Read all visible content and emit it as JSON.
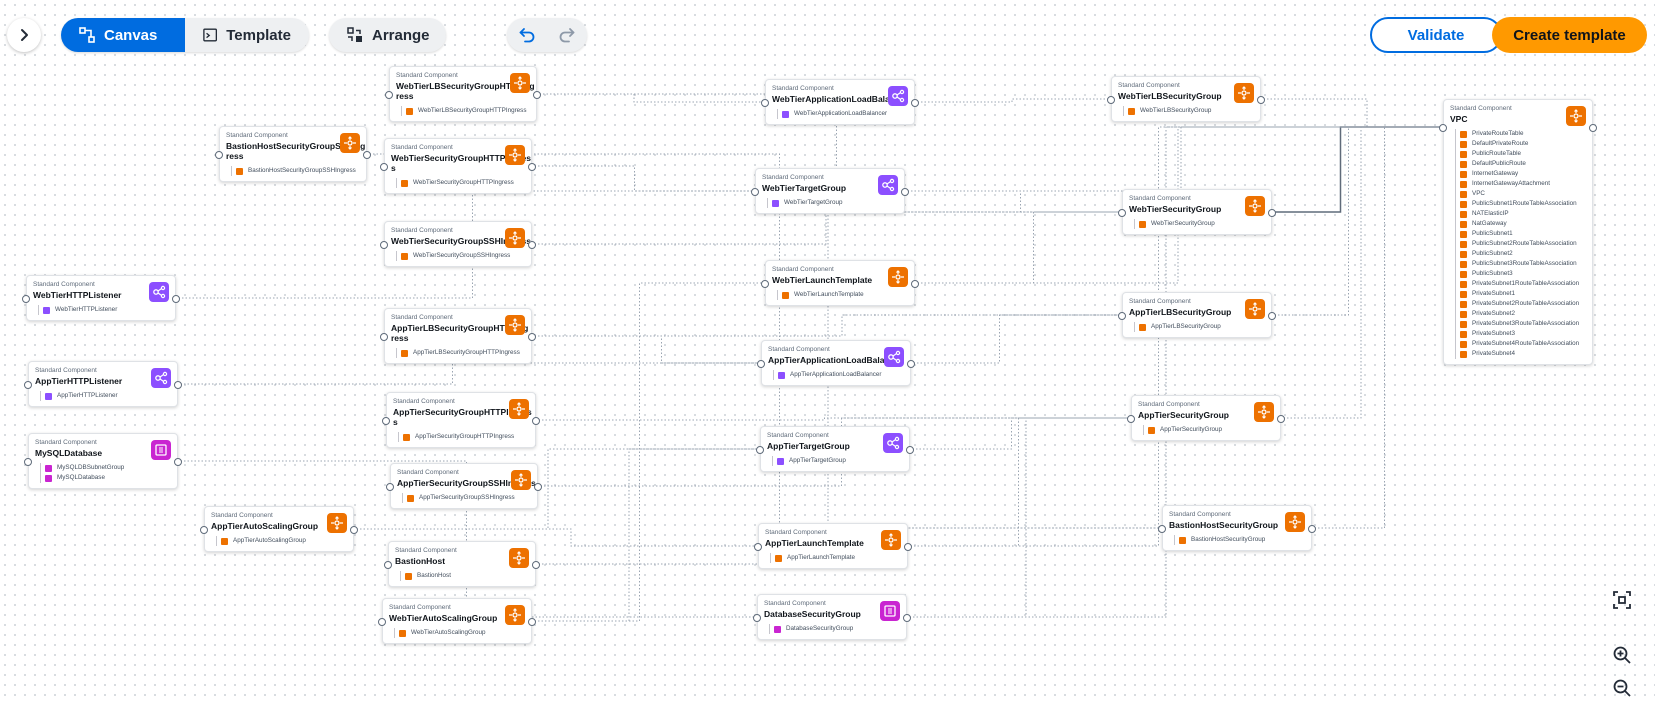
{
  "toolbar": {
    "canvas_label": "Canvas",
    "template_label": "Template",
    "arrange_label": "Arrange",
    "validate_label": "Validate",
    "create_label": "Create template"
  },
  "colors": {
    "accent": "#006ce0",
    "primary_action": "#ff9900",
    "compute": "#ed7100",
    "network": "#8c4fff",
    "database": "#c925d1"
  },
  "icons": {
    "expand": "chevron-right-icon",
    "canvas": "canvas-icon",
    "template": "terminal-icon",
    "arrange": "arrange-icon",
    "undo": "undo-icon",
    "redo": "redo-icon",
    "fit": "fit-view-icon",
    "zoom_in": "zoom-in-icon",
    "zoom_out": "zoom-out-icon"
  },
  "component_kind": "Standard Component",
  "cards": [
    {
      "title": "WebTierLBSecurityGroupHTTPIngress",
      "cat": "compute",
      "resources": [
        {
          "name": "WebTierLBSecurityGroupHTTPIngress",
          "cat": "compute"
        }
      ]
    },
    {
      "title": "BastionHostSecurityGroupSSHIngress",
      "cat": "compute",
      "resources": [
        {
          "name": "BastionHostSecurityGroupSSHIngress",
          "cat": "compute"
        }
      ]
    },
    {
      "title": "WebTierSecurityGroupHTTPIngress",
      "cat": "compute",
      "resources": [
        {
          "name": "WebTierSecurityGroupHTTPIngress",
          "cat": "compute"
        }
      ]
    },
    {
      "title": "WebTierSecurityGroupSSHIngress",
      "cat": "compute",
      "resources": [
        {
          "name": "WebTierSecurityGroupSSHIngress",
          "cat": "compute"
        }
      ]
    },
    {
      "title": "WebTierHTTPListener",
      "cat": "network",
      "resources": [
        {
          "name": "WebTierHTTPListener",
          "cat": "network"
        }
      ]
    },
    {
      "title": "AppTierLBSecurityGroupHTTPIngress",
      "cat": "compute",
      "resources": [
        {
          "name": "AppTierLBSecurityGroupHTTPIngress",
          "cat": "compute"
        }
      ]
    },
    {
      "title": "AppTierHTTPListener",
      "cat": "network",
      "resources": [
        {
          "name": "AppTierHTTPListener",
          "cat": "network"
        }
      ]
    },
    {
      "title": "AppTierSecurityGroupHTTPIngress",
      "cat": "compute",
      "resources": [
        {
          "name": "AppTierSecurityGroupHTTPIngress",
          "cat": "compute"
        }
      ]
    },
    {
      "title": "MySQLDatabase",
      "cat": "database",
      "resources": [
        {
          "name": "MySQLDBSubnetGroup",
          "cat": "database"
        },
        {
          "name": "MySQLDatabase",
          "cat": "database"
        }
      ]
    },
    {
      "title": "AppTierSecurityGroupSSHIngress",
      "cat": "compute",
      "resources": [
        {
          "name": "AppTierSecurityGroupSSHIngress",
          "cat": "compute"
        }
      ]
    },
    {
      "title": "AppTierAutoScalingGroup",
      "cat": "compute",
      "resources": [
        {
          "name": "AppTierAutoScalingGroup",
          "cat": "compute"
        }
      ]
    },
    {
      "title": "BastionHost",
      "cat": "compute",
      "resources": [
        {
          "name": "BastionHost",
          "cat": "compute"
        }
      ]
    },
    {
      "title": "WebTierAutoScalingGroup",
      "cat": "compute",
      "resources": [
        {
          "name": "WebTierAutoScalingGroup",
          "cat": "compute"
        }
      ]
    },
    {
      "title": "WebTierApplicationLoadBalancer",
      "cat": "network",
      "resources": [
        {
          "name": "WebTierApplicationLoadBalancer",
          "cat": "network"
        }
      ]
    },
    {
      "title": "WebTierTargetGroup",
      "cat": "network",
      "resources": [
        {
          "name": "WebTierTargetGroup",
          "cat": "network"
        }
      ]
    },
    {
      "title": "WebTierLaunchTemplate",
      "cat": "compute",
      "resources": [
        {
          "name": "WebTierLaunchTemplate",
          "cat": "compute"
        }
      ]
    },
    {
      "title": "AppTierApplicationLoadBalancer",
      "cat": "network",
      "resources": [
        {
          "name": "AppTierApplicationLoadBalancer",
          "cat": "network"
        }
      ]
    },
    {
      "title": "AppTierTargetGroup",
      "cat": "network",
      "resources": [
        {
          "name": "AppTierTargetGroup",
          "cat": "network"
        }
      ]
    },
    {
      "title": "AppTierLaunchTemplate",
      "cat": "compute",
      "resources": [
        {
          "name": "AppTierLaunchTemplate",
          "cat": "compute"
        }
      ]
    },
    {
      "title": "DatabaseSecurityGroup",
      "cat": "database",
      "resources": [
        {
          "name": "DatabaseSecurityGroup",
          "cat": "database"
        }
      ]
    },
    {
      "title": "WebTierLBSecurityGroup",
      "cat": "compute",
      "resources": [
        {
          "name": "WebTierLBSecurityGroup",
          "cat": "compute"
        }
      ]
    },
    {
      "title": "WebTierSecurityGroup",
      "cat": "compute",
      "resources": [
        {
          "name": "WebTierSecurityGroup",
          "cat": "compute"
        }
      ]
    },
    {
      "title": "AppTierLBSecurityGroup",
      "cat": "compute",
      "resources": [
        {
          "name": "AppTierLBSecurityGroup",
          "cat": "compute"
        }
      ]
    },
    {
      "title": "AppTierSecurityGroup",
      "cat": "compute",
      "resources": [
        {
          "name": "AppTierSecurityGroup",
          "cat": "compute"
        }
      ]
    },
    {
      "title": "BastionHostSecurityGroup",
      "cat": "compute",
      "resources": [
        {
          "name": "BastionHostSecurityGroup",
          "cat": "compute"
        }
      ]
    },
    {
      "title": "VPC",
      "cat": "compute",
      "resources": [
        {
          "name": "PrivateRouteTable",
          "cat": "compute"
        },
        {
          "name": "DefaultPrivateRoute",
          "cat": "compute"
        },
        {
          "name": "PublicRouteTable",
          "cat": "compute"
        },
        {
          "name": "DefaultPublicRoute",
          "cat": "compute"
        },
        {
          "name": "InternetGateway",
          "cat": "compute"
        },
        {
          "name": "InternetGatewayAttachment",
          "cat": "compute"
        },
        {
          "name": "VPC",
          "cat": "compute"
        },
        {
          "name": "PublicSubnet1RouteTableAssociation",
          "cat": "compute"
        },
        {
          "name": "NATElasticIP",
          "cat": "compute"
        },
        {
          "name": "NatGateway",
          "cat": "compute"
        },
        {
          "name": "PublicSubnet1",
          "cat": "compute"
        },
        {
          "name": "PublicSubnet2RouteTableAssociation",
          "cat": "compute"
        },
        {
          "name": "PublicSubnet2",
          "cat": "compute"
        },
        {
          "name": "PublicSubnet3RouteTableAssociation",
          "cat": "compute"
        },
        {
          "name": "PublicSubnet3",
          "cat": "compute"
        },
        {
          "name": "PrivateSubnet1RouteTableAssociation",
          "cat": "compute"
        },
        {
          "name": "PrivateSubnet1",
          "cat": "compute"
        },
        {
          "name": "PrivateSubnet2RouteTableAssociation",
          "cat": "compute"
        },
        {
          "name": "PrivateSubnet2",
          "cat": "compute"
        },
        {
          "name": "PrivateSubnet3RouteTableAssociation",
          "cat": "compute"
        },
        {
          "name": "PrivateSubnet3",
          "cat": "compute"
        },
        {
          "name": "PrivateSubnet4RouteTableAssociation",
          "cat": "compute"
        },
        {
          "name": "PrivateSubnet4",
          "cat": "compute"
        }
      ]
    }
  ]
}
